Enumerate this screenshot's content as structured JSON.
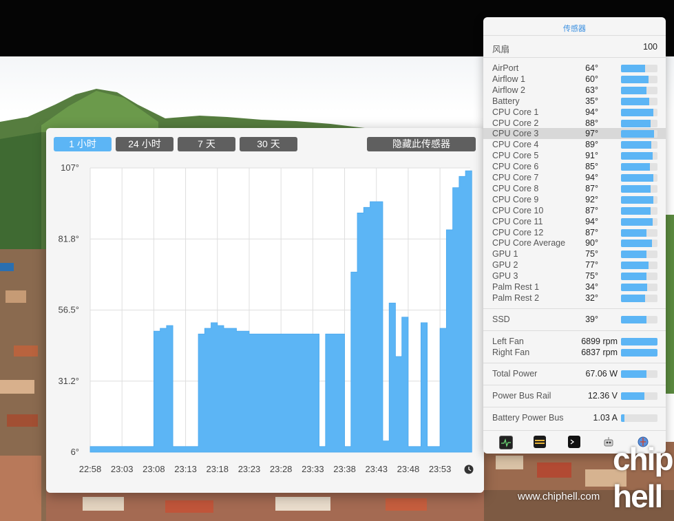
{
  "history": {
    "ranges": [
      "1 小时",
      "24 小时",
      "7 天",
      "30 天"
    ],
    "active_range": 0,
    "hide_button": "隐藏此传感器"
  },
  "chart_data": {
    "type": "area",
    "title": "",
    "xlabel": "",
    "ylabel": "",
    "ylim": [
      6,
      107
    ],
    "y_ticks": [
      "107°",
      "81.8°",
      "56.5°",
      "31.2°",
      "6°"
    ],
    "x_ticks": [
      "22:58",
      "23:03",
      "23:08",
      "23:13",
      "23:18",
      "23:23",
      "23:28",
      "23:33",
      "23:38",
      "23:43",
      "23:48",
      "23:53"
    ],
    "grid": true,
    "series": [
      {
        "values_note": "",
        "x": [
          "22:58",
          "23:03",
          "23:07",
          "23:08",
          "23:09",
          "23:10",
          "23:11",
          "23:12",
          "23:13",
          "23:14",
          "23:15",
          "23:16",
          "23:17",
          "23:18",
          "23:19",
          "23:20",
          "23:21",
          "23:22",
          "23:23",
          "23:24",
          "23:25",
          "23:26",
          "23:27",
          "23:28",
          "23:29",
          "23:30",
          "23:31",
          "23:32",
          "23:33",
          "23:34",
          "23:35",
          "23:36",
          "23:37",
          "23:38",
          "23:39",
          "23:40",
          "23:41",
          "23:42",
          "23:43",
          "23:44",
          "23:45",
          "23:46",
          "23:47",
          "23:48",
          "23:49",
          "23:50",
          "23:51",
          "23:52",
          "23:53",
          "23:54",
          "23:55",
          "23:56",
          "23:57",
          "23:58"
        ],
        "values": [
          8,
          8,
          8,
          49,
          50,
          51,
          8,
          8,
          8,
          8,
          48,
          50,
          52,
          51,
          50,
          50,
          49,
          49,
          48,
          48,
          48,
          48,
          48,
          48,
          48,
          48,
          48,
          48,
          48,
          8,
          48,
          48,
          48,
          8,
          70,
          91,
          93,
          95,
          95,
          10,
          59,
          40,
          54,
          8,
          8,
          52,
          8,
          8,
          50,
          85,
          100,
          104,
          106,
          106
        ]
      }
    ]
  },
  "sensors": {
    "title": "传感器",
    "fan_label": "风扇",
    "fan_value": "100",
    "temps": [
      {
        "name": "AirPort",
        "value": "64°",
        "level": 0.66
      },
      {
        "name": "Airflow 1",
        "value": "60°",
        "level": 0.75
      },
      {
        "name": "Airflow 2",
        "value": "63°",
        "level": 0.7
      },
      {
        "name": "Battery",
        "value": "35°",
        "level": 0.77
      },
      {
        "name": "CPU Core 1",
        "value": "94°",
        "level": 0.88
      },
      {
        "name": "CPU Core 2",
        "value": "88°",
        "level": 0.82
      },
      {
        "name": "CPU Core 3",
        "value": "97°",
        "level": 0.9
      },
      {
        "name": "CPU Core 4",
        "value": "89°",
        "level": 0.83
      },
      {
        "name": "CPU Core 5",
        "value": "91°",
        "level": 0.87
      },
      {
        "name": "CPU Core 6",
        "value": "85°",
        "level": 0.8
      },
      {
        "name": "CPU Core 7",
        "value": "94°",
        "level": 0.88
      },
      {
        "name": "CPU Core 8",
        "value": "87°",
        "level": 0.81
      },
      {
        "name": "CPU Core 9",
        "value": "92°",
        "level": 0.88
      },
      {
        "name": "CPU Core 10",
        "value": "87°",
        "level": 0.81
      },
      {
        "name": "CPU Core 11",
        "value": "94°",
        "level": 0.87
      },
      {
        "name": "CPU Core 12",
        "value": "87°",
        "level": 0.7
      },
      {
        "name": "CPU Core Average",
        "value": "90°",
        "level": 0.85
      },
      {
        "name": "GPU 1",
        "value": "75°",
        "level": 0.7
      },
      {
        "name": "GPU 2",
        "value": "77°",
        "level": 0.75
      },
      {
        "name": "GPU 3",
        "value": "75°",
        "level": 0.7
      },
      {
        "name": "Palm Rest 1",
        "value": "34°",
        "level": 0.72
      },
      {
        "name": "Palm Rest 2",
        "value": "32°",
        "level": 0.66
      }
    ],
    "ssd": {
      "name": "SSD",
      "value": "39°",
      "level": 0.7
    },
    "fans": [
      {
        "name": "Left Fan",
        "value": "6899 rpm",
        "level": 1.0
      },
      {
        "name": "Right Fan",
        "value": "6837 rpm",
        "level": 1.0
      }
    ],
    "total_power": {
      "name": "Total Power",
      "value": "67.06 W",
      "level": 0.7
    },
    "power_bus_rail": {
      "name": "Power Bus Rail",
      "value": "12.36 V",
      "level": 0.65
    },
    "battery_power_bus": {
      "name": "Battery Power Bus",
      "value": "1.03 A",
      "level": 0.1
    },
    "highlighted_row": "CPU Core 3",
    "toolbar_icons": [
      "activity-monitor-icon",
      "macs-fan-control-icon",
      "terminal-icon",
      "robot-icon",
      "network-globe-icon"
    ]
  },
  "watermark": {
    "site": "www.chiphell.com",
    "logo": "chip hell"
  },
  "colors": {
    "accent": "#5cb5f5",
    "title_blue": "#3a8fe0",
    "button_gray": "#5f5f5f"
  }
}
